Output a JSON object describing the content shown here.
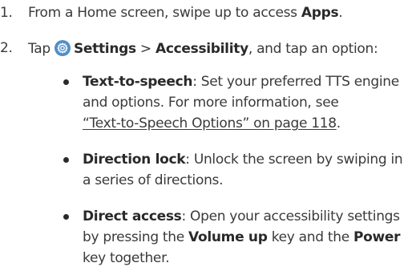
{
  "steps": [
    {
      "number": "1.",
      "text_before": "From a Home screen, swipe up to access ",
      "bold": "Apps",
      "text_after": "."
    },
    {
      "number": "2.",
      "text_before": "Tap ",
      "icon": "settings-gear-icon",
      "bold_settings": "Settings",
      "separator": " > ",
      "bold_accessibility": "Accessibility",
      "text_after": ", and tap an option:"
    }
  ],
  "options": [
    {
      "term": "Text-to-speech",
      "line1_rest": ": Set your preferred TTS engine",
      "line2": "and options. For more information, see",
      "link": "“Text-to-Speech Options” on page 118",
      "link_after": "."
    },
    {
      "term": "Direction lock",
      "line1_rest": ": Unlock the screen by swiping in",
      "line2": "a series of directions."
    },
    {
      "term": "Direct access",
      "line1_rest": ": Open your accessibility settings",
      "line2_before": "by pressing the ",
      "line2_bold1": "Volume up",
      "line2_mid": " key and the ",
      "line2_bold2": "Power",
      "line3": "key together."
    }
  ],
  "colors": {
    "text": "#3a3a3a",
    "icon_bg": "#4f8ec9"
  }
}
